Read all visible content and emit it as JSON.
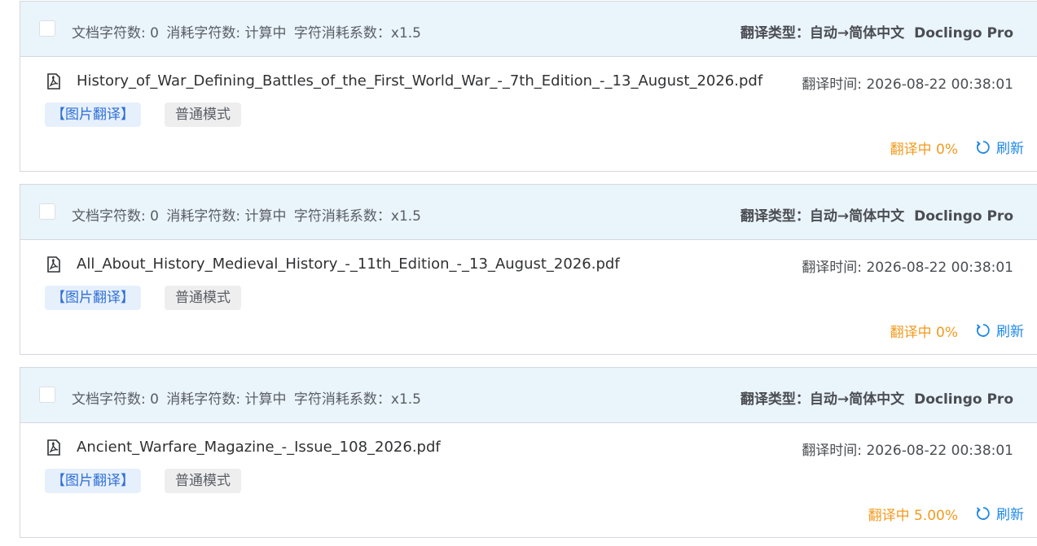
{
  "tasks": [
    {
      "stats": {
        "doc_chars": "文档字符数: 0",
        "consumed_chars": "消耗字符数: 计算中",
        "coefficient": "字符消耗系数：x1.5"
      },
      "translate_type": "翻译类型：自动→简体中文",
      "engine": "Doclingo Pro",
      "file_name": "History_of_War_Defining_Battles_of_the_First_World_War_-_7th_Edition_-_13_August_2026.pdf",
      "time": "翻译时间: 2026-08-22 00:38:01",
      "tag_image": "【图片翻译】",
      "tag_mode": "普通模式",
      "status": "翻译中 0%",
      "refresh_label": "刷新"
    },
    {
      "stats": {
        "doc_chars": "文档字符数: 0",
        "consumed_chars": "消耗字符数: 计算中",
        "coefficient": "字符消耗系数：x1.5"
      },
      "translate_type": "翻译类型：自动→简体中文",
      "engine": "Doclingo Pro",
      "file_name": "All_About_History_Medieval_History_-_11th_Edition_-_13_August_2026.pdf",
      "time": "翻译时间: 2026-08-22 00:38:01",
      "tag_image": "【图片翻译】",
      "tag_mode": "普通模式",
      "status": "翻译中 0%",
      "refresh_label": "刷新"
    },
    {
      "stats": {
        "doc_chars": "文档字符数: 0",
        "consumed_chars": "消耗字符数: 计算中",
        "coefficient": "字符消耗系数：x1.5"
      },
      "translate_type": "翻译类型：自动→简体中文",
      "engine": "Doclingo Pro",
      "file_name": "Ancient_Warfare_Magazine_-_Issue_108_2026.pdf",
      "time": "翻译时间: 2026-08-22 00:38:01",
      "tag_image": "【图片翻译】",
      "tag_mode": "普通模式",
      "status": "翻译中 5.00%",
      "refresh_label": "刷新"
    }
  ],
  "icons": {
    "file": "pdf-file-icon",
    "refresh": "refresh-icon"
  },
  "colors": {
    "header_bg": "#eaf4fb",
    "status_orange": "#f29a1d",
    "link_blue": "#1e88e5",
    "tag_blue": "#2f6fd6"
  }
}
